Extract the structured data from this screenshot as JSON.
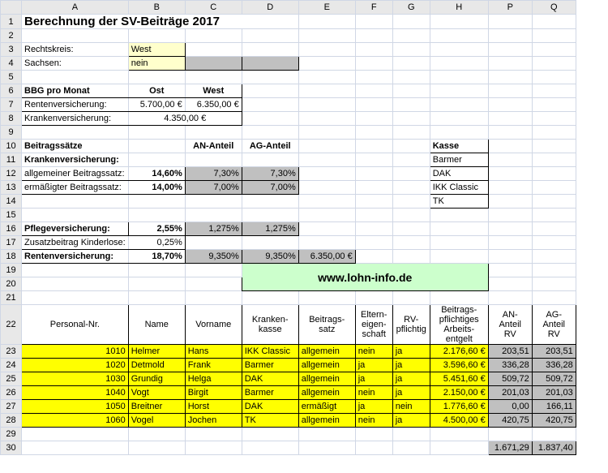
{
  "title": "Berechnung der SV-Beiträge 2017",
  "labels": {
    "rechtskreis": "Rechtskreis:",
    "sachsen": "Sachsen:",
    "bbg": "BBG pro Monat",
    "ost": "Ost",
    "west": "West",
    "rv": "Rentenversicherung:",
    "kv": "Krankenversicherung:",
    "beitragssaetze": "Beitragssätze",
    "an_anteil": "AN-Anteil",
    "ag_anteil": "AG-Anteil",
    "kv_line": "Krankenversicherung:",
    "allgemein_bs": "allgemeiner Beitragssatz:",
    "ermaessigt_bs": "ermäßigter Beitragssatz:",
    "pv": "Pflegeversicherung:",
    "zusatz_kinderlose": "Zusatzbeitrag Kinderlose:",
    "rv_line": "Rentenversicherung:",
    "kasse": "Kasse",
    "banner": "www.lohn-info.de"
  },
  "inputs": {
    "rechtskreis_v": "West",
    "sachsen_v": "nein"
  },
  "bbg": {
    "rv_ost": "5.700,00 €",
    "rv_west": "6.350,00 €",
    "kv": "4.350,00 €"
  },
  "rates": {
    "kv_allg_total": "14,60%",
    "kv_allg_an": "7,30%",
    "kv_allg_ag": "7,30%",
    "kv_erm_total": "14,00%",
    "kv_erm_an": "7,00%",
    "kv_erm_ag": "7,00%",
    "pv_total": "2,55%",
    "pv_an": "1,275%",
    "pv_ag": "1,275%",
    "zusatz_kl": "0,25%",
    "rv_total": "18,70%",
    "rv_an": "9,350%",
    "rv_ag": "9,350%",
    "rv_bbg": "6.350,00 €"
  },
  "kassen": [
    "Barmer",
    "DAK",
    "IKK Classic",
    "TK"
  ],
  "cols": {
    "pnr": "Personal-Nr.",
    "name": "Name",
    "vorname": "Vorname",
    "kasse1": "Kranken-",
    "kasse2": "kasse",
    "bs1": "Beitrags-",
    "bs2": "satz",
    "eltern1": "Eltern-",
    "eltern2": "eigen-",
    "eltern3": "schaft",
    "rvp1": "RV-",
    "rvp2": "pflichtig",
    "ent1": "Beitrags-",
    "ent2": "pflichtiges",
    "ent3": "Arbeits-",
    "ent4": "entgelt",
    "anrv1": "AN-",
    "anrv2": "Anteil",
    "anrv3": "RV",
    "agrv1": "AG-",
    "agrv2": "Anteil",
    "agrv3": "RV"
  },
  "rows": [
    {
      "pnr": "1010",
      "name": "Helmer",
      "vorname": "Hans",
      "kasse": "IKK Classic",
      "bs": "allgemein",
      "eltern": "nein",
      "rvp": "ja",
      "ent": "2.176,60 €",
      "an": "203,51",
      "ag": "203,51"
    },
    {
      "pnr": "1020",
      "name": "Detmold",
      "vorname": "Frank",
      "kasse": "Barmer",
      "bs": "allgemein",
      "eltern": "ja",
      "rvp": "ja",
      "ent": "3.596,60 €",
      "an": "336,28",
      "ag": "336,28"
    },
    {
      "pnr": "1030",
      "name": "Grundig",
      "vorname": "Helga",
      "kasse": "DAK",
      "bs": "allgemein",
      "eltern": "ja",
      "rvp": "ja",
      "ent": "5.451,60 €",
      "an": "509,72",
      "ag": "509,72"
    },
    {
      "pnr": "1040",
      "name": "Vogt",
      "vorname": "Birgit",
      "kasse": "Barmer",
      "bs": "allgemein",
      "eltern": "nein",
      "rvp": "ja",
      "ent": "2.150,00 €",
      "an": "201,03",
      "ag": "201,03"
    },
    {
      "pnr": "1050",
      "name": "Breitner",
      "vorname": "Horst",
      "kasse": "DAK",
      "bs": "ermäßigt",
      "eltern": "ja",
      "rvp": "nein",
      "ent": "1.776,60 €",
      "an": "0,00",
      "ag": "166,11"
    },
    {
      "pnr": "1060",
      "name": "Vogel",
      "vorname": "Jochen",
      "kasse": "TK",
      "bs": "allgemein",
      "eltern": "nein",
      "rvp": "ja",
      "ent": "4.500,00 €",
      "an": "420,75",
      "ag": "420,75"
    }
  ],
  "totals": {
    "an": "1.671,29",
    "ag": "1.837,40"
  },
  "chart_data": {
    "type": "table",
    "title": "Berechnung der SV-Beiträge 2017",
    "columns": [
      "Personal-Nr.",
      "Name",
      "Vorname",
      "Krankenkasse",
      "Beitragssatz",
      "Elterneigenschaft",
      "RV-pflichtig",
      "Beitragspflichtiges Arbeitsentgelt (€)",
      "AN-Anteil RV",
      "AG-Anteil RV"
    ],
    "rows": [
      [
        1010,
        "Helmer",
        "Hans",
        "IKK Classic",
        "allgemein",
        "nein",
        "ja",
        2176.6,
        203.51,
        203.51
      ],
      [
        1020,
        "Detmold",
        "Frank",
        "Barmer",
        "allgemein",
        "ja",
        "ja",
        3596.6,
        336.28,
        336.28
      ],
      [
        1030,
        "Grundig",
        "Helga",
        "DAK",
        "allgemein",
        "ja",
        "ja",
        5451.6,
        509.72,
        509.72
      ],
      [
        1040,
        "Vogt",
        "Birgit",
        "Barmer",
        "allgemein",
        "nein",
        "ja",
        2150.0,
        201.03,
        201.03
      ],
      [
        1050,
        "Breitner",
        "Horst",
        "DAK",
        "ermäßigt",
        "ja",
        "nein",
        1776.6,
        0.0,
        166.11
      ],
      [
        1060,
        "Vogel",
        "Jochen",
        "TK",
        "allgemein",
        "nein",
        "ja",
        4500.0,
        420.75,
        420.75
      ]
    ],
    "totals": {
      "AN-Anteil RV": 1671.29,
      "AG-Anteil RV": 1837.4
    }
  }
}
